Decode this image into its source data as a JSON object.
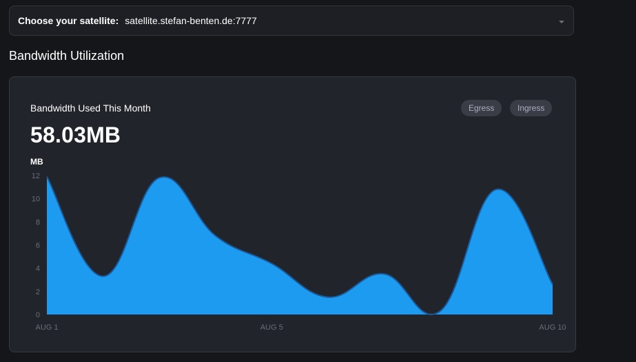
{
  "satellite": {
    "label": "Choose your satellite:",
    "value": "satellite.stefan-benten.de:7777"
  },
  "section_title": "Bandwidth Utilization",
  "card": {
    "title": "Bandwidth Used This Month",
    "total": "58.03MB",
    "unit": "MB",
    "buttons": [
      "Egress",
      "Ingress"
    ]
  },
  "colors": {
    "area_fill": "#1d9bf0",
    "area_stroke": "#1a5a9a",
    "background": "#151619",
    "card": "#22242b"
  },
  "chart_data": {
    "type": "area",
    "ylabel": "MB",
    "ylim": [
      0,
      12
    ],
    "y_ticks": [
      0,
      2,
      4,
      6,
      8,
      10,
      12
    ],
    "x_tick_labels": [
      "AUG 1",
      "AUG 5",
      "AUG 10"
    ],
    "grid": false,
    "series": [
      {
        "x": [
          "AUG 1",
          "AUG 2",
          "AUG 3",
          "AUG 4",
          "AUG 5",
          "AUG 6",
          "AUG 7",
          "AUG 8",
          "AUG 9",
          "AUG 10"
        ],
        "values": [
          11.9,
          3.3,
          11.8,
          6.8,
          4.4,
          1.5,
          3.5,
          0.3,
          10.8,
          2.6
        ]
      }
    ]
  }
}
